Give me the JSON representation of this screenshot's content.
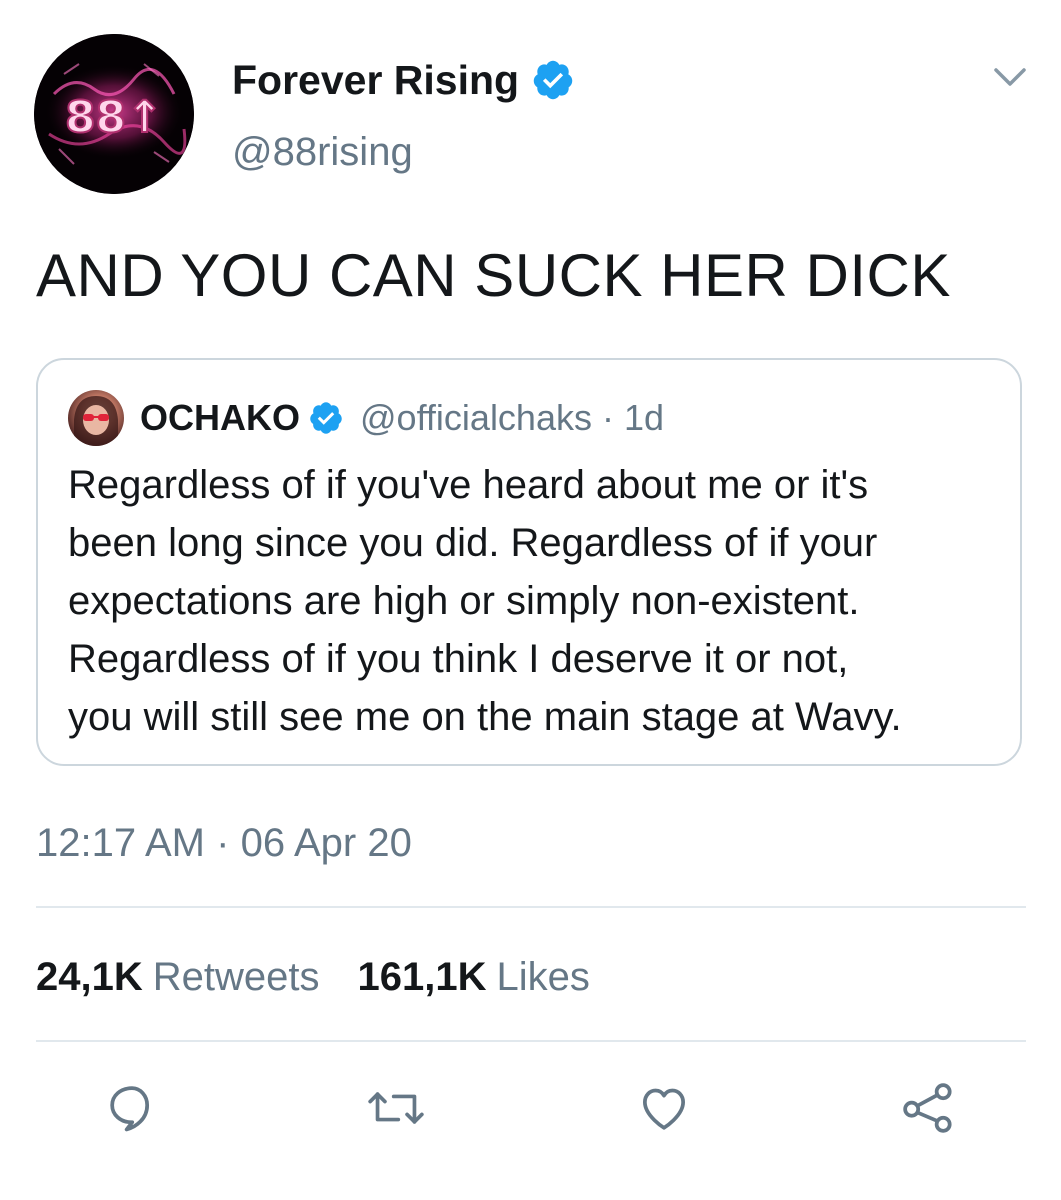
{
  "author": {
    "display_name": "Forever Rising",
    "handle": "@88rising",
    "avatar_text": "88↑",
    "verified": true
  },
  "tweet": {
    "text": "AND YOU CAN SUCK HER DICK",
    "time": "12:17 AM",
    "separator": "·",
    "date": "06 Apr 20"
  },
  "quoted": {
    "display_name": "OCHAKO",
    "handle": "@officialchaks",
    "separator": "·",
    "age": "1d",
    "verified": true,
    "lines": [
      "Regardless of if you've heard about me or it's",
      "been long since you did. Regardless of if your",
      "expectations are high or simply non-existent.",
      "Regardless of if you think I deserve it or not,",
      "you will still see me on the main stage at Wavy."
    ]
  },
  "stats": {
    "retweets_count": "24,1K",
    "retweets_label": "Retweets",
    "likes_count": "161,1K",
    "likes_label": "Likes"
  },
  "actions": {
    "icons": [
      "reply-icon",
      "retweet-icon",
      "like-icon",
      "share-icon"
    ]
  },
  "colors": {
    "verified_blue": "#1da1f2",
    "secondary_text": "#657786",
    "divider": "#e1e8ed",
    "card_border": "#ccd6dd"
  }
}
